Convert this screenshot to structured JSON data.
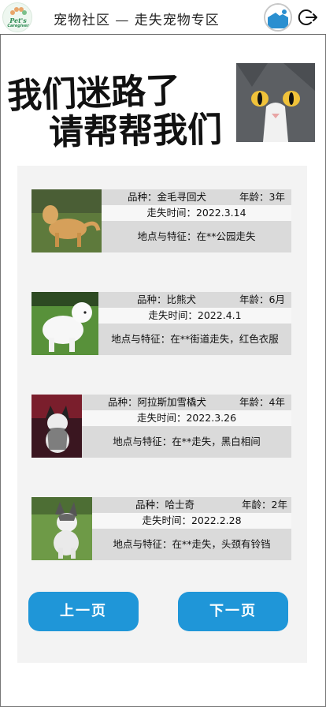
{
  "header": {
    "logo_line1": "Pet's",
    "logo_line2": "Caregiver",
    "title": "宠物社区 — 走失宠物专区"
  },
  "banner": {
    "line1": "我们迷路了",
    "line2": "请帮帮我们"
  },
  "pets": [
    {
      "breed": "品种：金毛寻回犬",
      "age": "年龄：3年",
      "lost_time": "走失时间：2022.3.14",
      "detail": "地点与特征：在**公园走失"
    },
    {
      "breed": "品种：比熊犬",
      "age": "年龄：6月",
      "lost_time": "走失时间：2022.4.1",
      "detail": "地点与特征：在**街道走失，红色衣服"
    },
    {
      "breed": "品种：阿拉斯加雪橇犬",
      "age": "年龄：4年",
      "lost_time": "走失时间：2022.3.26",
      "detail": "地点与特征：在**走失，黑白相间"
    },
    {
      "breed": "品种：哈士奇",
      "age": "年龄：2年",
      "lost_time": "走失时间：2022.2.28",
      "detail": "地点与特征：在**走失，头颈有铃铛"
    }
  ],
  "pagination": {
    "prev_label": "上一页",
    "next_label": "下一页"
  },
  "colors": {
    "accent": "#1f96d8",
    "panel_bg": "#f3f3f3",
    "row_bg": "#dadada"
  },
  "icons": [
    "logo-icon",
    "avatar-icon",
    "logout-icon"
  ]
}
